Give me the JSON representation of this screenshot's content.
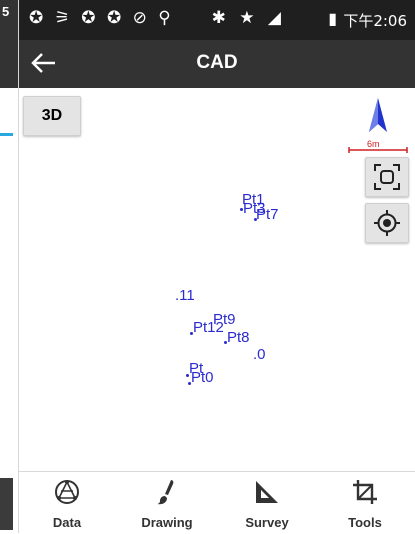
{
  "left_panel": {
    "status_fragment": "5"
  },
  "status_bar": {
    "time": "下午2:06",
    "left_icons": "✪ ⚞ ✪ ✪ ⊘ ⚲",
    "right_icons": "✱ ★ ◢"
  },
  "app_bar": {
    "title": "CAD"
  },
  "map": {
    "view_toggle_label": "3D",
    "scale_label": "6m",
    "points": [
      {
        "label": "Pt1"
      },
      {
        "label": "Pt3"
      },
      {
        "label": "Pt7"
      },
      {
        "label": ".11"
      },
      {
        "label": "Pt9"
      },
      {
        "label": "Pt12"
      },
      {
        "label": "Pt8"
      },
      {
        "label": ".0"
      },
      {
        "label": "Pt"
      },
      {
        "label": "Pt0"
      }
    ]
  },
  "bottom_nav": {
    "items": [
      {
        "label": "Data",
        "icon": "data-icon"
      },
      {
        "label": "Drawing",
        "icon": "brush-icon"
      },
      {
        "label": "Survey",
        "icon": "triangle-ruler-icon"
      },
      {
        "label": "Tools",
        "icon": "crop-icon"
      }
    ]
  },
  "colors": {
    "points": "#2b2bd0",
    "appbar": "#333333",
    "statusbar": "#1f1f1f",
    "north": "#2233cc",
    "scale": "#d02020"
  }
}
